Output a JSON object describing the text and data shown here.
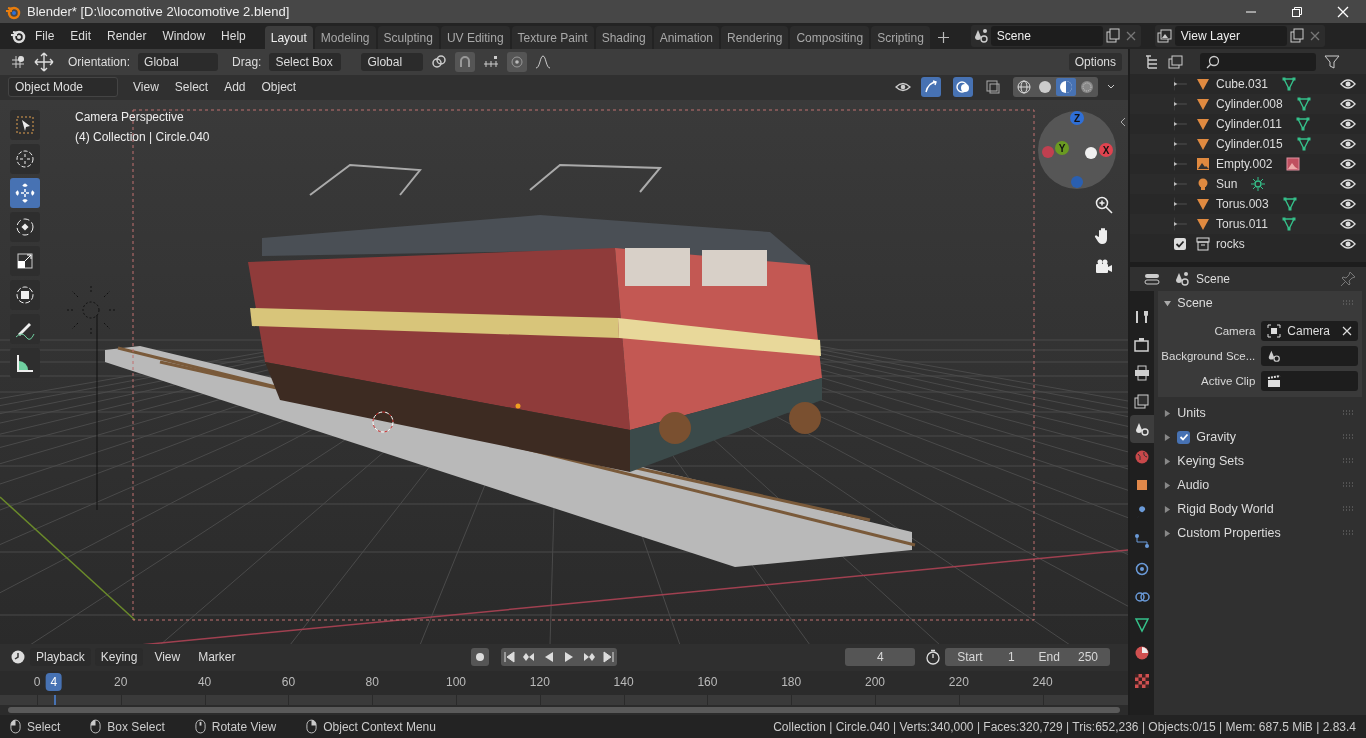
{
  "window": {
    "title": "Blender* [D:\\locomotive 2\\locomotive 2.blend]"
  },
  "menu": [
    "File",
    "Edit",
    "Render",
    "Window",
    "Help"
  ],
  "workspace_tabs": [
    {
      "label": "Layout",
      "selected": true
    },
    {
      "label": "Modeling",
      "selected": false
    },
    {
      "label": "Sculpting",
      "selected": false
    },
    {
      "label": "UV Editing",
      "selected": false
    },
    {
      "label": "Texture Paint",
      "selected": false
    },
    {
      "label": "Shading",
      "selected": false
    },
    {
      "label": "Animation",
      "selected": false
    },
    {
      "label": "Rendering",
      "selected": false
    },
    {
      "label": "Compositing",
      "selected": false
    },
    {
      "label": "Scripting",
      "selected": false
    }
  ],
  "scene_selector": {
    "value": "Scene"
  },
  "view_layer_selector": {
    "value": "View Layer"
  },
  "tool_settings": {
    "orientation_label": "Orientation:",
    "orientation": "Global",
    "drag_label": "Drag:",
    "drag": "Select Box",
    "pivot_orientation": "Global",
    "options": "Options"
  },
  "viewport_header": {
    "mode": "Object Mode",
    "menus": [
      "View",
      "Select",
      "Add",
      "Object"
    ],
    "shading": [
      {
        "kind": "wireframe",
        "selected": false
      },
      {
        "kind": "solid",
        "selected": false
      },
      {
        "kind": "material",
        "selected": true
      },
      {
        "kind": "rendered",
        "selected": false
      }
    ]
  },
  "toolbar": [
    {
      "kind": "select-box",
      "selected": false
    },
    {
      "kind": "cursor",
      "selected": false
    },
    {
      "kind": "move",
      "selected": true
    },
    {
      "kind": "rotate",
      "selected": false
    },
    {
      "kind": "scale",
      "selected": false
    },
    {
      "kind": "transform",
      "selected": false
    },
    {
      "kind": "annotate",
      "selected": false
    },
    {
      "kind": "measure",
      "selected": false
    }
  ],
  "viewport": {
    "view_name": "Camera Perspective",
    "info": "(4) Collection | Circle.040",
    "gizmo_axes": [
      {
        "label": "Z",
        "color": "#2f6fd6"
      },
      {
        "label": "Y",
        "color": "#6a9a22"
      },
      {
        "label": "X",
        "color": "#e0434f"
      }
    ]
  },
  "outliner": {
    "items": [
      {
        "name": "Cube.031",
        "kind": "mesh",
        "visible": true
      },
      {
        "name": "Cylinder.008",
        "kind": "mesh",
        "visible": true
      },
      {
        "name": "Cylinder.011",
        "kind": "mesh",
        "visible": true
      },
      {
        "name": "Cylinder.015",
        "kind": "mesh",
        "visible": true
      },
      {
        "name": "Empty.002",
        "kind": "image",
        "visible": true
      },
      {
        "name": "Sun",
        "kind": "light",
        "visible": true
      },
      {
        "name": "Torus.003",
        "kind": "mesh",
        "visible": true
      },
      {
        "name": "Torus.011",
        "kind": "mesh",
        "visible": true
      },
      {
        "name": "rocks",
        "kind": "collection",
        "visible": true,
        "checked": true
      }
    ]
  },
  "properties": {
    "context": "Scene",
    "tabs": [
      {
        "kind": "tool",
        "selected": false
      },
      {
        "kind": "render",
        "selected": false
      },
      {
        "kind": "output",
        "selected": false
      },
      {
        "kind": "view-layer",
        "selected": false
      },
      {
        "kind": "scene",
        "selected": true
      },
      {
        "kind": "world",
        "selected": false
      },
      {
        "kind": "object",
        "selected": false
      },
      {
        "kind": "modifier",
        "selected": false
      },
      {
        "kind": "particles",
        "selected": false
      },
      {
        "kind": "physics",
        "selected": false
      },
      {
        "kind": "constraints",
        "selected": false
      },
      {
        "kind": "data",
        "selected": false
      },
      {
        "kind": "material",
        "selected": false
      },
      {
        "kind": "texture",
        "selected": false
      }
    ],
    "panel": {
      "title": "Scene",
      "expanded": true,
      "fields": [
        {
          "label": "Camera",
          "kind": "object",
          "value": "Camera"
        },
        {
          "label": "Background Sce...",
          "kind": "scene"
        },
        {
          "label": "Active Clip",
          "kind": "clip"
        }
      ]
    },
    "subpanels": [
      {
        "title": "Units",
        "kind": "plain",
        "expanded": false
      },
      {
        "title": "Gravity",
        "kind": "checkbox",
        "checked": true,
        "expanded": false
      },
      {
        "title": "Keying Sets",
        "kind": "plain",
        "expanded": false
      },
      {
        "title": "Audio",
        "kind": "plain",
        "expanded": false
      },
      {
        "title": "Rigid Body World",
        "kind": "plain",
        "expanded": false
      },
      {
        "title": "Custom Properties",
        "kind": "plain",
        "expanded": false
      }
    ]
  },
  "timeline": {
    "menus": [
      "Playback",
      "Keying"
    ],
    "plain_menus": [
      "View",
      "Marker"
    ],
    "current_frame": "4",
    "start_label": "Start",
    "start": "1",
    "end_label": "End",
    "end": "250",
    "playhead": "4",
    "ruler": [
      "0",
      "20",
      "40",
      "60",
      "80",
      "100",
      "120",
      "140",
      "160",
      "180",
      "200",
      "220",
      "240"
    ]
  },
  "status_bar": {
    "hints": [
      {
        "kind": "left",
        "label": "Select"
      },
      {
        "kind": "drag",
        "label": "Box Select"
      },
      {
        "kind": "middle",
        "label": "Rotate View"
      },
      {
        "kind": "right",
        "label": "Object Context Menu"
      }
    ],
    "stats": "Collection | Circle.040 | Verts:340,000 | Faces:320,729 | Tris:652,236 | Objects:0/15 | Mem: 687.5 MiB | 2.83.4"
  }
}
